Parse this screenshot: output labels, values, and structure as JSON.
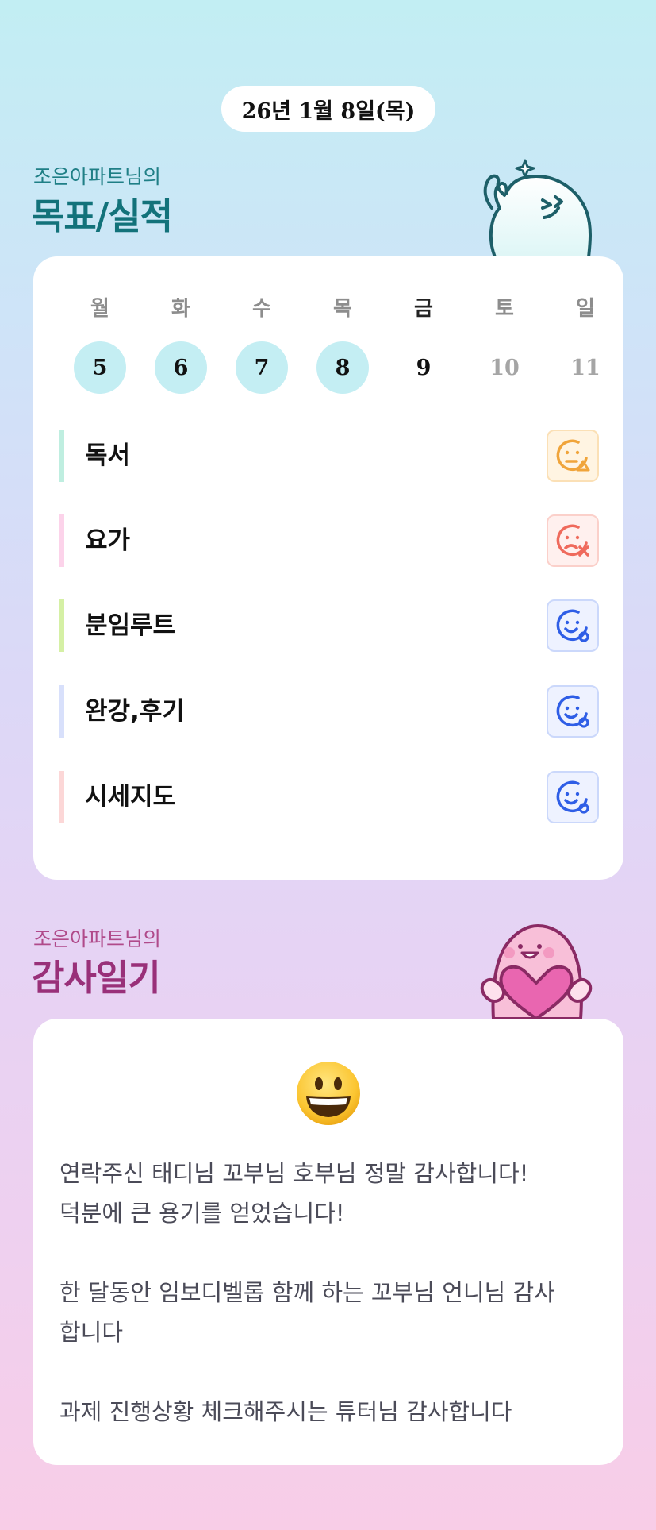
{
  "date_label": "26년 1월 8일(목)",
  "goals_section": {
    "subtitle": "조은아파트님의",
    "title": "목표/실적"
  },
  "week": {
    "days": [
      {
        "label": "월",
        "date": "5",
        "state": "done"
      },
      {
        "label": "화",
        "date": "6",
        "state": "done"
      },
      {
        "label": "수",
        "date": "7",
        "state": "done"
      },
      {
        "label": "목",
        "date": "8",
        "state": "done"
      },
      {
        "label": "금",
        "date": "9",
        "state": "today"
      },
      {
        "label": "토",
        "date": "10",
        "state": "future"
      },
      {
        "label": "일",
        "date": "11",
        "state": "future"
      }
    ]
  },
  "goals": [
    {
      "name": "독서",
      "bar_color": "#bfeee0",
      "status_icon": "partial-face-icon",
      "badge_bg": "#fff4e2",
      "badge_border": "#fbe0b6",
      "icon_color": "#f0a43a"
    },
    {
      "name": "요가",
      "bar_color": "#fcd3ea",
      "status_icon": "fail-face-icon",
      "badge_bg": "#fff0ee",
      "badge_border": "#fbd0ca",
      "icon_color": "#ef6a5c"
    },
    {
      "name": "분임루트",
      "bar_color": "#d5f0a5",
      "status_icon": "success-face-icon",
      "badge_bg": "#eef2ff",
      "badge_border": "#cbd8fb",
      "icon_color": "#2f5ee6"
    },
    {
      "name": "완강,후기",
      "bar_color": "#d8e0fb",
      "status_icon": "success-face-icon",
      "badge_bg": "#eef2ff",
      "badge_border": "#cbd8fb",
      "icon_color": "#2f5ee6"
    },
    {
      "name": "시세지도",
      "bar_color": "#fcd7d7",
      "status_icon": "success-face-icon",
      "badge_bg": "#eef2ff",
      "badge_border": "#cbd8fb",
      "icon_color": "#2f5ee6"
    }
  ],
  "thanks_section": {
    "subtitle": "조은아파트님의",
    "title": "감사일기",
    "emoji": "grinning-face-emoji",
    "lines": [
      "연락주신 태디님 꼬부님 호부님 정말 감사합니다!",
      "덕분에 큰 용기를 얻었습니다!",
      "",
      "한 달동안 임보디벨롭 함께 하는 꼬부님 언니님 감사",
      "합니다",
      "",
      "과제 진행상황 체크해주시는 튜터님 감사합니다"
    ]
  },
  "colors": {
    "done_circle": "#c4eef3",
    "goals_title": "#12727a",
    "thanks_title": "#993079"
  }
}
